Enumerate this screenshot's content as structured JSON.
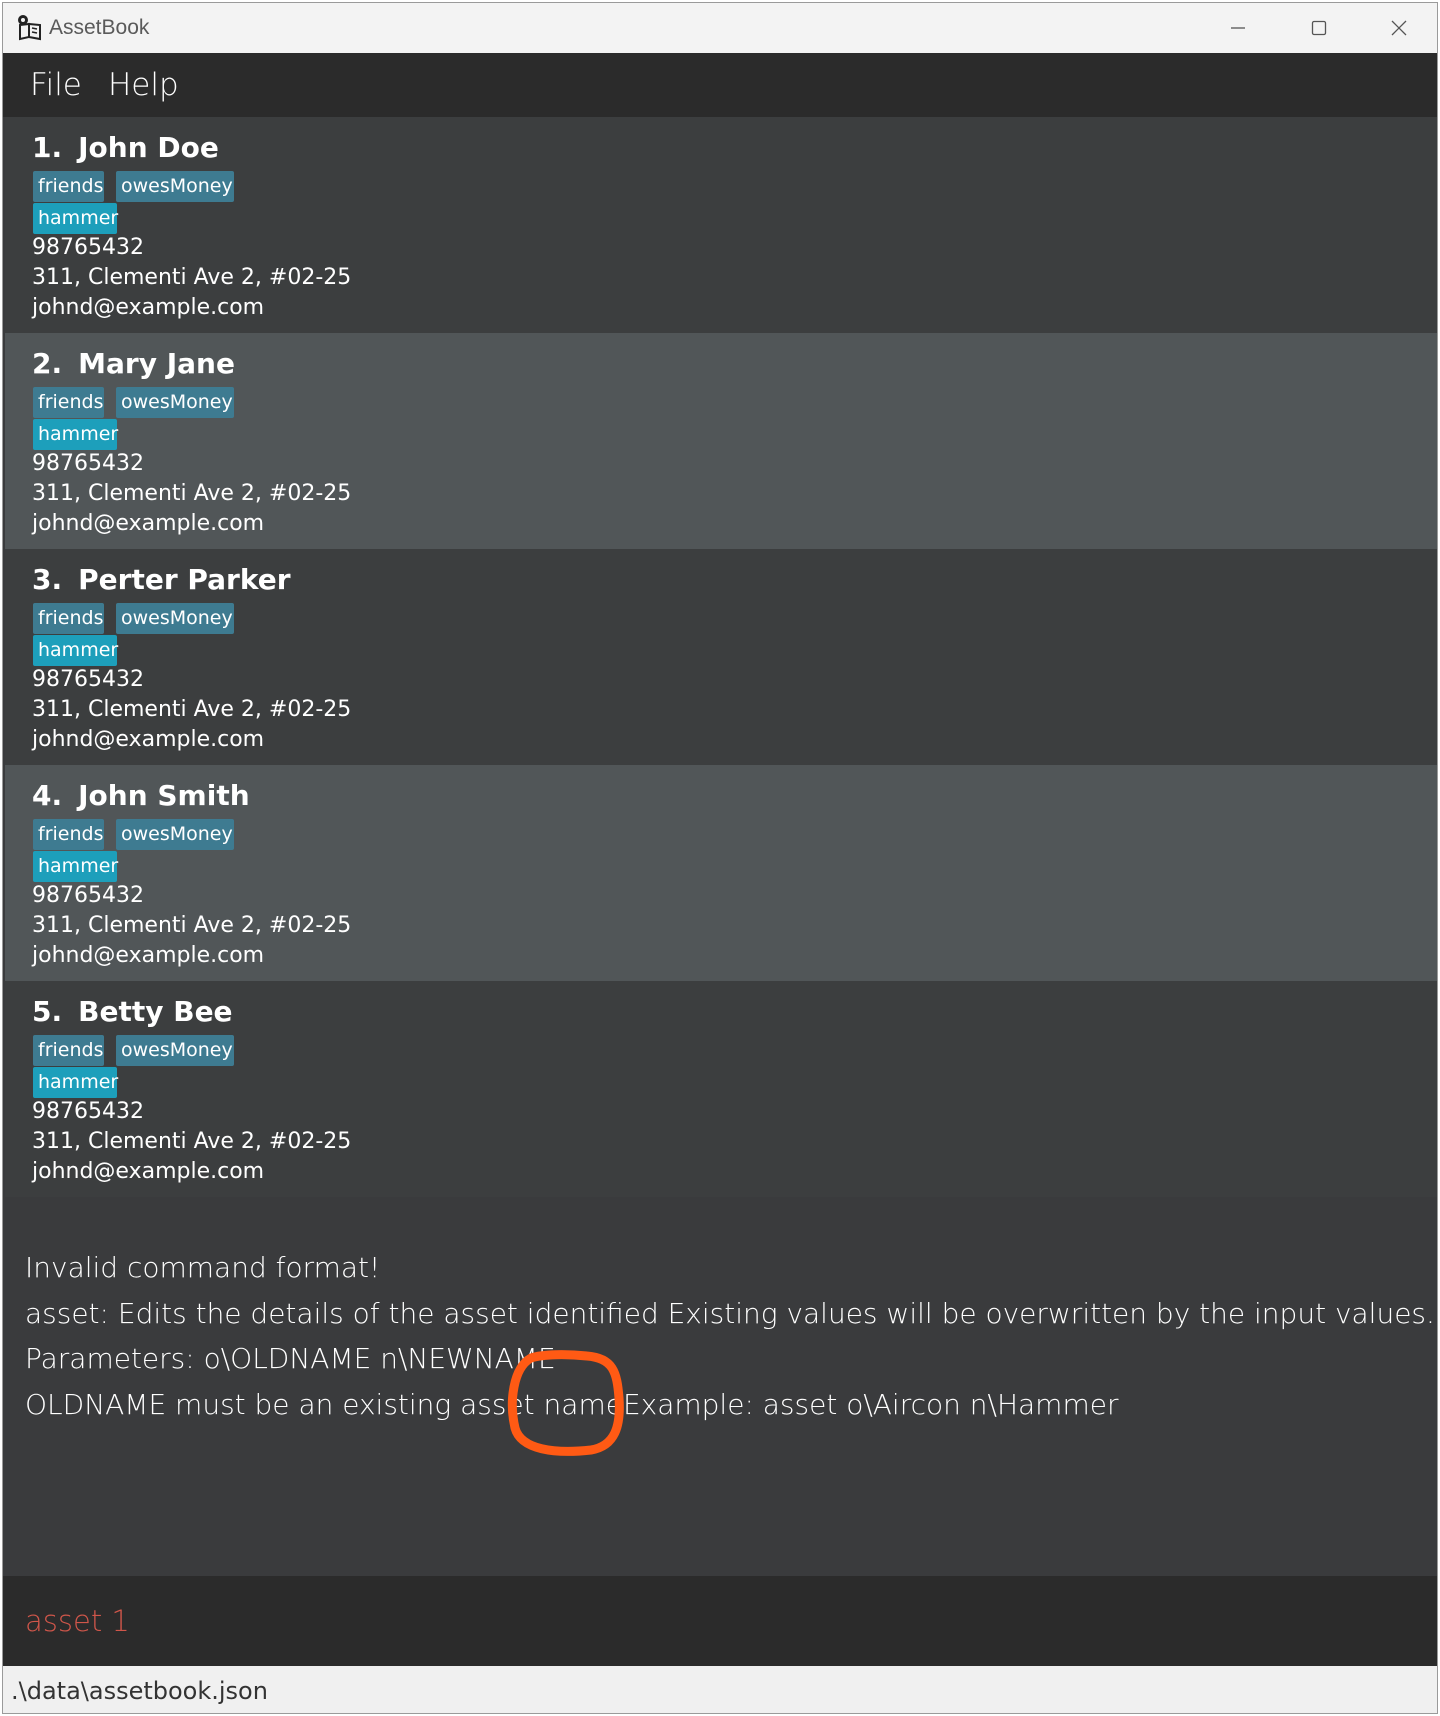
{
  "window": {
    "title": "AssetBook",
    "icon": "book-gear-icon"
  },
  "menu": {
    "file": "File",
    "help": "Help"
  },
  "persons": [
    {
      "index": "1.",
      "name": "John Doe",
      "tags": [
        "friends",
        "owesMoney"
      ],
      "assets": [
        "hammer"
      ],
      "phone": "98765432",
      "address": "311, Clementi Ave 2, #02-25",
      "email": "johnd@example.com"
    },
    {
      "index": "2.",
      "name": "Mary Jane",
      "tags": [
        "friends",
        "owesMoney"
      ],
      "assets": [
        "hammer"
      ],
      "phone": "98765432",
      "address": "311, Clementi Ave 2, #02-25",
      "email": "johnd@example.com"
    },
    {
      "index": "3.",
      "name": "Perter Parker",
      "tags": [
        "friends",
        "owesMoney"
      ],
      "assets": [
        "hammer"
      ],
      "phone": "98765432",
      "address": "311, Clementi Ave 2, #02-25",
      "email": "johnd@example.com"
    },
    {
      "index": "4.",
      "name": "John Smith",
      "tags": [
        "friends",
        "owesMoney"
      ],
      "assets": [
        "hammer"
      ],
      "phone": "98765432",
      "address": "311, Clementi Ave 2, #02-25",
      "email": "johnd@example.com"
    },
    {
      "index": "5.",
      "name": "Betty Bee",
      "tags": [
        "friends",
        "owesMoney"
      ],
      "assets": [
        "hammer"
      ],
      "phone": "98765432",
      "address": "311, Clementi Ave 2, #02-25",
      "email": "johnd@example.com"
    }
  ],
  "result": {
    "lines": [
      "Invalid command format!",
      "asset: Edits the details of the asset identified Existing values will be overwritten by the input values.",
      "Parameters: o\\OLDNAME n\\NEWNAME",
      "OLDNAME must be an existing asset nameExample: asset o\\Aircon n\\Hammer"
    ]
  },
  "command": {
    "value": "asset 1"
  },
  "status": {
    "file_path": ".\\data\\assetbook.json"
  },
  "colors": {
    "tag": "#3e7b91",
    "asset_tag": "#1d9fbb",
    "command_text": "#d0564a",
    "annotation": "#ff5a14"
  }
}
